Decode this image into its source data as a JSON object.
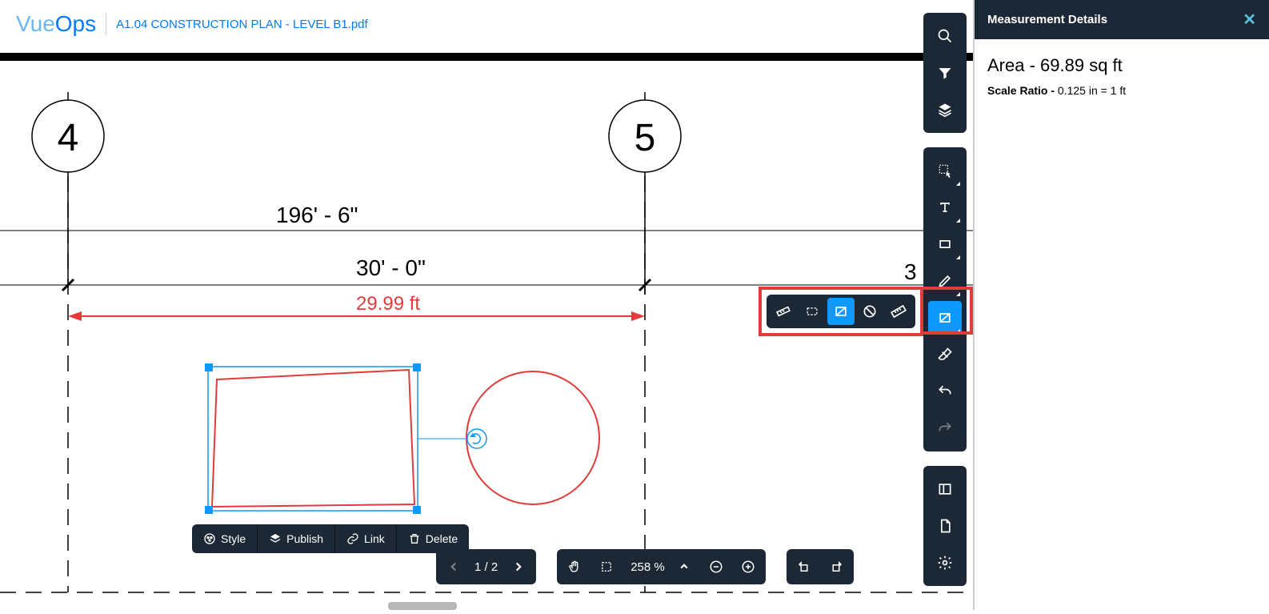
{
  "header": {
    "logo_main": "Vue",
    "logo_sub": "Ops",
    "filename": "A1.04 CONSTRUCTION PLAN - LEVEL B1.pdf"
  },
  "canvas": {
    "label_4": "4",
    "label_5": "5",
    "dim_long": "196' - 6\"",
    "dim_short": "30' - 0\"",
    "dim_cut": "3",
    "measurement_label": "29.99 ft"
  },
  "context": {
    "style": "Style",
    "publish": "Publish",
    "link": "Link",
    "delete": "Delete"
  },
  "bottom": {
    "page": "1 / 2",
    "zoom": "258 %"
  },
  "panel": {
    "title": "Measurement Details",
    "area_label": "Area - ",
    "area_value": "69.89 sq ft",
    "scale_label": "Scale Ratio - ",
    "scale_value": "0.125 in = 1 ft"
  }
}
